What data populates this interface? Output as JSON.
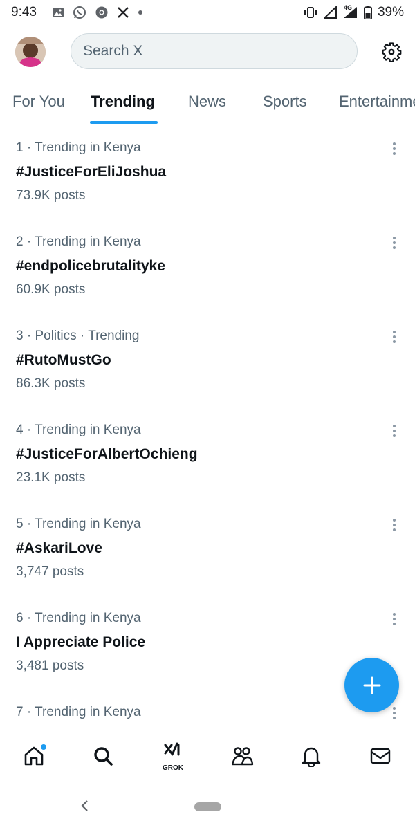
{
  "status_bar": {
    "time": "9:43",
    "left_icons": [
      "image-icon",
      "whatsapp-icon",
      "chrome-icon",
      "x-icon",
      "dot-icon"
    ],
    "network": "4G",
    "battery": "39%"
  },
  "header": {
    "search_placeholder": "Search X"
  },
  "tabs": [
    {
      "label": "For You",
      "active": false
    },
    {
      "label": "Trending",
      "active": true
    },
    {
      "label": "News",
      "active": false
    },
    {
      "label": "Sports",
      "active": false
    },
    {
      "label": "Entertainment",
      "active": false
    }
  ],
  "trends": [
    {
      "rank": "1",
      "context": "Trending in Kenya",
      "name": "#JusticeForEliJoshua",
      "posts": "73.9K posts"
    },
    {
      "rank": "2",
      "context": "Trending in Kenya",
      "name": "#endpolicebrutalityke",
      "posts": "60.9K posts"
    },
    {
      "rank": "3",
      "context": "Politics · Trending",
      "name": "#RutoMustGo",
      "posts": "86.3K posts"
    },
    {
      "rank": "4",
      "context": "Trending in Kenya",
      "name": "#JusticeForAlbertOchieng",
      "posts": "23.1K posts"
    },
    {
      "rank": "5",
      "context": "Trending in Kenya",
      "name": "#AskariLove",
      "posts": "3,747 posts"
    },
    {
      "rank": "6",
      "context": "Trending in Kenya",
      "name": "I Appreciate Police",
      "posts": "3,481 posts"
    },
    {
      "rank": "7",
      "context": "Trending in Kenya",
      "name": "",
      "posts": ""
    }
  ],
  "bottom_nav": {
    "items": [
      "home-icon",
      "search-icon",
      "grok-icon",
      "communities-icon",
      "notifications-icon",
      "messages-icon"
    ],
    "grok_label": "GROK"
  },
  "colors": {
    "accent": "#1d9bf0",
    "text_primary": "#0f1419",
    "text_secondary": "#536471",
    "search_bg": "#eff3f4"
  }
}
